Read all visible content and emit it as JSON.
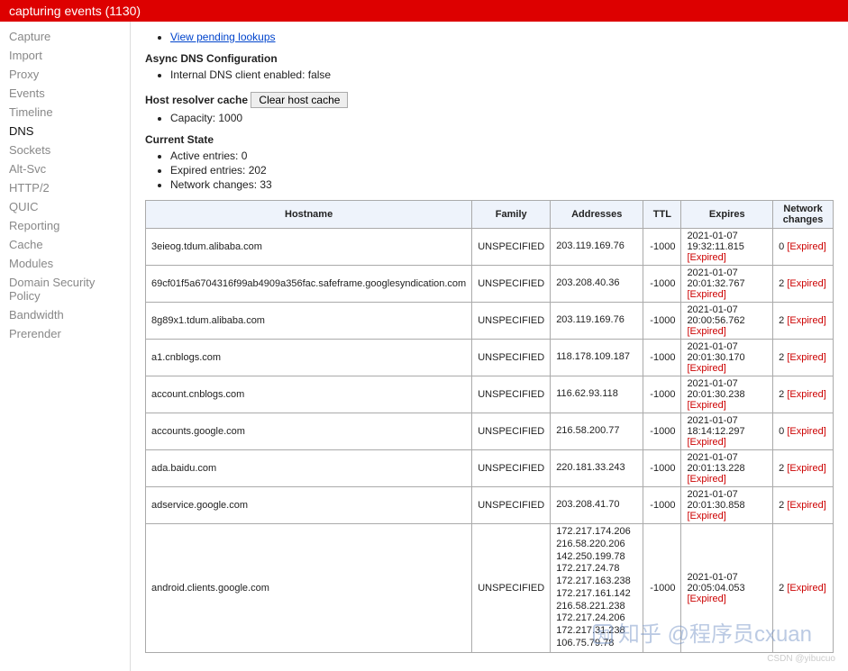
{
  "header": {
    "title": "capturing events (1130)"
  },
  "sidebar": {
    "items": [
      {
        "label": "Capture"
      },
      {
        "label": "Import"
      },
      {
        "label": "Proxy"
      },
      {
        "label": "Events"
      },
      {
        "label": "Timeline"
      },
      {
        "label": "DNS",
        "active": true
      },
      {
        "label": "Sockets"
      },
      {
        "label": "Alt-Svc"
      },
      {
        "label": "HTTP/2"
      },
      {
        "label": "QUIC"
      },
      {
        "label": "Reporting"
      },
      {
        "label": "Cache"
      },
      {
        "label": "Modules"
      },
      {
        "label": "Domain Security Policy"
      },
      {
        "label": "Bandwidth"
      },
      {
        "label": "Prerender"
      }
    ]
  },
  "links": {
    "pending": "View pending lookups"
  },
  "async_dns": {
    "title": "Async DNS Configuration",
    "client_line": "Internal DNS client enabled: false"
  },
  "cache": {
    "title": "Host resolver cache",
    "clear_btn": "Clear host cache",
    "capacity_line": "Capacity: 1000"
  },
  "current_state": {
    "title": "Current State",
    "active_line": "Active entries: 0",
    "expired_line": "Expired entries: 202",
    "changes_line": "Network changes: 33"
  },
  "table": {
    "headers": {
      "host": "Hostname",
      "family": "Family",
      "addr": "Addresses",
      "ttl": "TTL",
      "expires": "Expires",
      "changes": "Network changes"
    },
    "expired_tag": "[Expired]",
    "rows": [
      {
        "host": "3eieog.tdum.alibaba.com",
        "family": "UNSPECIFIED",
        "addr": "203.119.169.76",
        "ttl": "-1000",
        "expires": "2021-01-07 19:32:11.815",
        "changes": "0"
      },
      {
        "host": "69cf01f5a6704316f99ab4909a356fac.safeframe.googlesyndication.com",
        "family": "UNSPECIFIED",
        "addr": "203.208.40.36",
        "ttl": "-1000",
        "expires": "2021-01-07 20:01:32.767",
        "changes": "2"
      },
      {
        "host": "8g89x1.tdum.alibaba.com",
        "family": "UNSPECIFIED",
        "addr": "203.119.169.76",
        "ttl": "-1000",
        "expires": "2021-01-07 20:00:56.762",
        "changes": "2"
      },
      {
        "host": "a1.cnblogs.com",
        "family": "UNSPECIFIED",
        "addr": "118.178.109.187",
        "ttl": "-1000",
        "expires": "2021-01-07 20:01:30.170",
        "changes": "2"
      },
      {
        "host": "account.cnblogs.com",
        "family": "UNSPECIFIED",
        "addr": "116.62.93.118",
        "ttl": "-1000",
        "expires": "2021-01-07 20:01:30.238",
        "changes": "2"
      },
      {
        "host": "accounts.google.com",
        "family": "UNSPECIFIED",
        "addr": "216.58.200.77",
        "ttl": "-1000",
        "expires": "2021-01-07 18:14:12.297",
        "changes": "0"
      },
      {
        "host": "ada.baidu.com",
        "family": "UNSPECIFIED",
        "addr": "220.181.33.243",
        "ttl": "-1000",
        "expires": "2021-01-07 20:01:13.228",
        "changes": "2"
      },
      {
        "host": "adservice.google.com",
        "family": "UNSPECIFIED",
        "addr": "203.208.41.70",
        "ttl": "-1000",
        "expires": "2021-01-07 20:01:30.858",
        "changes": "2"
      },
      {
        "host": "android.clients.google.com",
        "family": "UNSPECIFIED",
        "addr": "172.217.174.206\n216.58.220.206\n142.250.199.78\n172.217.24.78\n172.217.163.238\n172.217.161.142\n216.58.221.238\n172.217.24.206\n172.217.31.238\n106.75.79.78",
        "ttl": "-1000",
        "expires": "2021-01-07 20:05:04.053",
        "changes": "2"
      }
    ]
  },
  "watermark": "知乎 @程序员cxuan",
  "credit": "CSDN @yibucuo"
}
